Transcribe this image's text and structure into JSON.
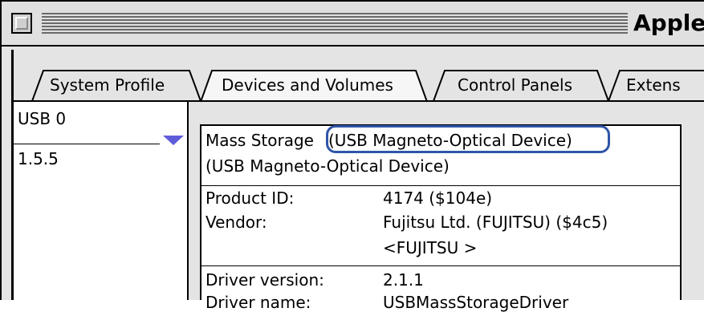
{
  "window": {
    "title": "Apple"
  },
  "tabs": [
    {
      "label": "System Profile",
      "active": false
    },
    {
      "label": "Devices and Volumes",
      "active": true
    },
    {
      "label": "Control Panels",
      "active": false
    },
    {
      "label": "Extens",
      "active": false
    }
  ],
  "device_list": {
    "bus": "USB 0",
    "version": "1.5.5"
  },
  "device_detail": {
    "name_prefix": "Mass Storage",
    "name_suffix": "(USB Magneto-Optical Device)",
    "subtitle": "(USB Magneto-Optical Device)",
    "fields": [
      {
        "label": "Product ID:",
        "value": "4174 ($104e)"
      },
      {
        "label": "Vendor:",
        "value": "Fujitsu Ltd. (FUJITSU) ($4c5)",
        "value2": "<FUJITSU >"
      },
      {
        "label": "Driver version:",
        "value": "2.1.1"
      },
      {
        "label": "Driver name:",
        "value": "USBMassStorageDriver"
      }
    ]
  },
  "colors": {
    "highlight": "#2e55a8",
    "disclosure_triangle": "#5e5cd8"
  }
}
